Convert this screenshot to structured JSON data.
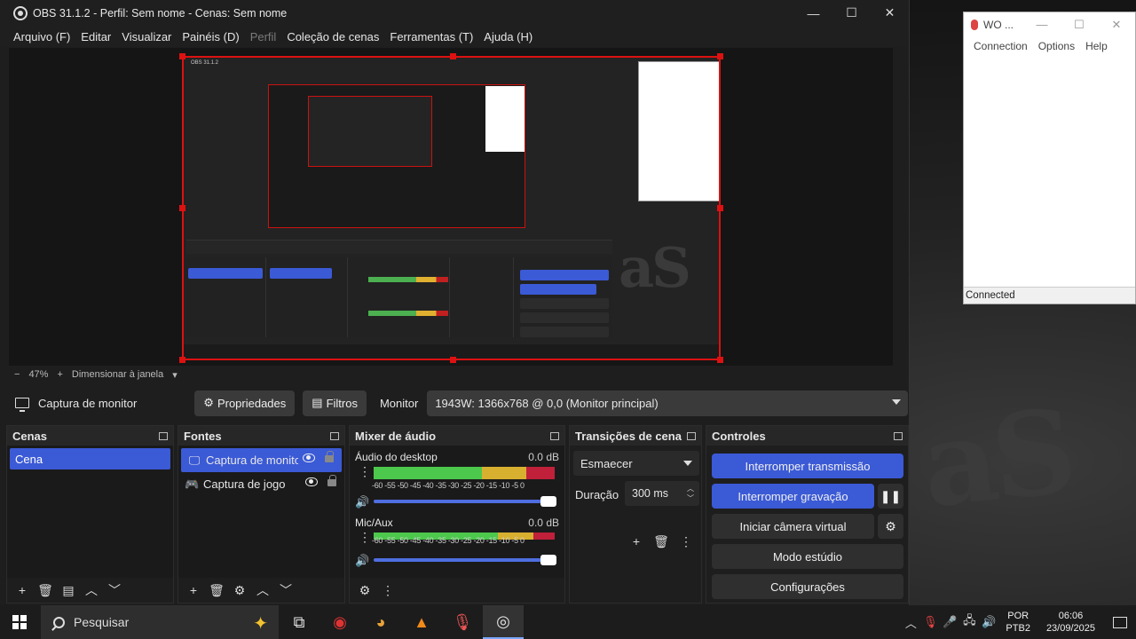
{
  "window": {
    "title": "OBS 31.1.2 - Perfil: Sem nome - Cenas: Sem nome",
    "minimize": "—",
    "maximize": "☐",
    "close": "✕"
  },
  "menu": [
    "Arquivo (F)",
    "Editar",
    "Visualizar",
    "Painéis (D)",
    "Perfil",
    "Coleção de cenas",
    "Ferramentas (T)",
    "Ajuda (H)"
  ],
  "zoom": {
    "minus": "−",
    "percent": "47%",
    "plus": "+",
    "mode": "Dimensionar à janela"
  },
  "source_bar": {
    "source_name": "Captura de monitor",
    "properties": "Propriedades",
    "filters": "Filtros",
    "monitor_label": "Monitor",
    "monitor_value": "1943W: 1366x768 @ 0,0 (Monitor principal)"
  },
  "scenes": {
    "title": "Cenas",
    "items": [
      "Cena"
    ]
  },
  "sources": {
    "title": "Fontes",
    "items": [
      "Captura de monitor",
      "Captura de jogo"
    ]
  },
  "mixer": {
    "title": "Mixer de áudio",
    "scale": "-60 -55 -50 -45 -40 -35 -30 -25 -20 -15 -10 -5 0",
    "channels": [
      {
        "name": "Áudio do desktop",
        "db": "0.0 dB",
        "level": 1.0
      },
      {
        "name": "Mic/Aux",
        "db": "0.0 dB",
        "level": 1.0
      }
    ]
  },
  "transitions": {
    "title": "Transições de cena",
    "selected": "Esmaecer",
    "duration_label": "Duração",
    "duration_value": "300 ms"
  },
  "controls": {
    "title": "Controles",
    "stop_stream": "Interromper transmissão",
    "stop_record": "Interromper gravação",
    "virtual_cam": "Iniciar câmera virtual",
    "studio_mode": "Modo estúdio",
    "settings": "Configurações"
  },
  "side_window": {
    "title": "WO ...",
    "menu": [
      "Connection",
      "Options",
      "Help"
    ],
    "status": "Connected"
  },
  "taskbar": {
    "search_placeholder": "Pesquisar",
    "lang_top": "POR",
    "lang_bottom": "PTB2",
    "time": "06:06",
    "date": "23/09/2025"
  },
  "colors": {
    "accent": "#3b5ad6",
    "selection_border": "#dd1111"
  }
}
